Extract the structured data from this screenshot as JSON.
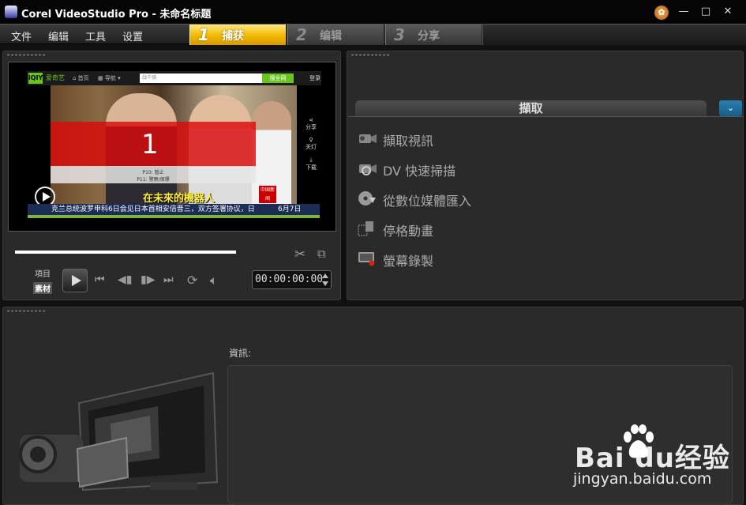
{
  "window": {
    "title": "Corel VideoStudio Pro - 未命名标题",
    "help_icon": "help-gear-icon",
    "minimize": "—",
    "maximize": "□",
    "close": "✕"
  },
  "menu": {
    "items": [
      "文件",
      "编辑",
      "工具",
      "设置"
    ]
  },
  "steps": [
    {
      "num": "1",
      "label": "捕获",
      "active": true
    },
    {
      "num": "2",
      "label": "编辑",
      "active": false
    },
    {
      "num": "3",
      "label": "分享",
      "active": false
    }
  ],
  "preview": {
    "browser": {
      "logo": "iQIY",
      "brand": "爱奇艺",
      "nav_home": "首页",
      "nav_guide": "导航",
      "search_placeholder": "战千骑",
      "search_button": "搜全网",
      "login": "登录"
    },
    "clip_number": "1",
    "clip_info_line1": "P10: 暂止",
    "clip_info_line2": "P11: 警察/保镖",
    "subtitle": "在未來的機器人",
    "mic_badge": "中国新闻",
    "side_share": "分享",
    "side_light": "关灯",
    "side_download": "下载",
    "ticker": "克兰总统波罗申科6日会见日本首相安倍晋三，双方签署协议，日",
    "ticker_date": "6月7日"
  },
  "controls": {
    "mode_project": "項目",
    "mode_clip": "素材",
    "timecode": "00:00:00:00",
    "icons": [
      "scissors-icon",
      "copy-icon",
      "home-icon",
      "prev-frame-icon",
      "next-frame-icon",
      "end-icon",
      "repeat-icon",
      "volume-icon"
    ]
  },
  "capture": {
    "header": "擷取",
    "collapse": "⌄",
    "options": [
      {
        "label": "擷取視訊",
        "icon": "camcorder-icon"
      },
      {
        "label": "DV 快速掃描",
        "icon": "dv-scan-icon"
      },
      {
        "label": "從數位媒體匯入",
        "icon": "disc-import-icon"
      },
      {
        "label": "停格動畫",
        "icon": "stop-motion-icon"
      },
      {
        "label": "螢幕錄製",
        "icon": "screen-record-icon"
      }
    ]
  },
  "info": {
    "label": "資訊:"
  },
  "watermark": {
    "main": "Bai du经验",
    "sub": "jingyan.baidu.com"
  }
}
